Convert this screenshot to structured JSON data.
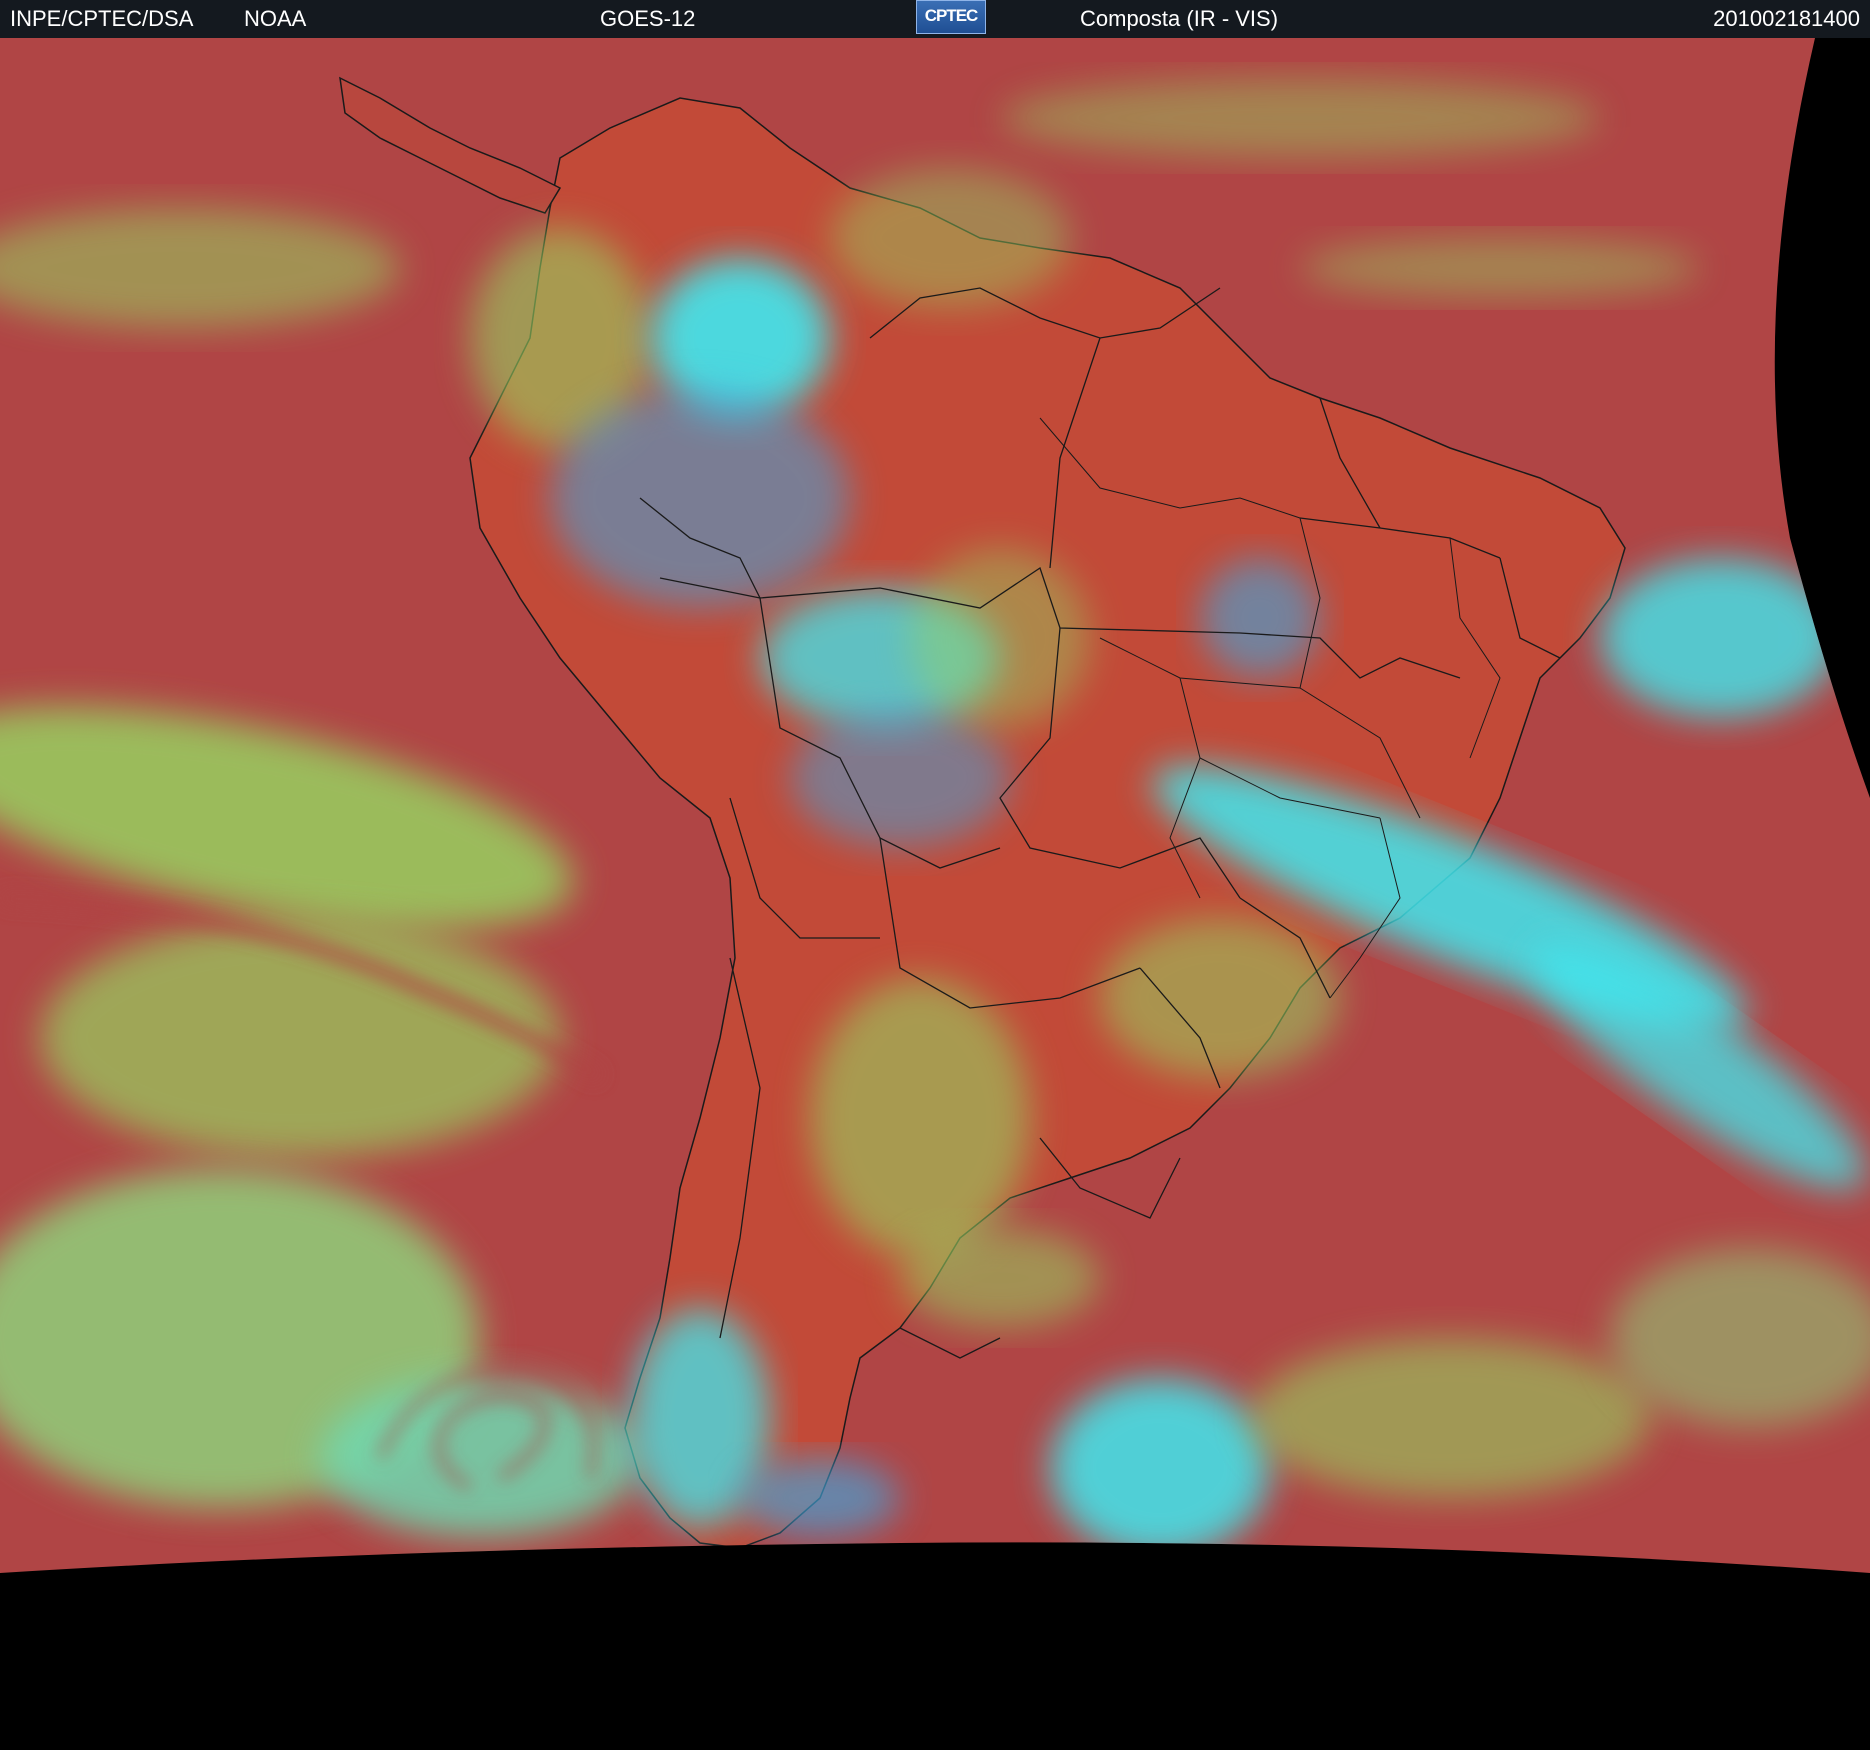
{
  "header": {
    "source": "INPE/CPTEC/DSA",
    "agency": "NOAA",
    "satellite": "GOES-12",
    "logo_text": "CPTEC",
    "product": "Composta (IR - VIS)",
    "timestamp": "201002181400"
  },
  "colors": {
    "header_bg": "#14191f",
    "ocean_clear": "#b04545",
    "land_clear": "#c24a38",
    "low_cloud": "#98d060",
    "high_cloud": "#40e8f0",
    "mid_cloud": "#3fa8e0",
    "no_data": "#000000"
  }
}
